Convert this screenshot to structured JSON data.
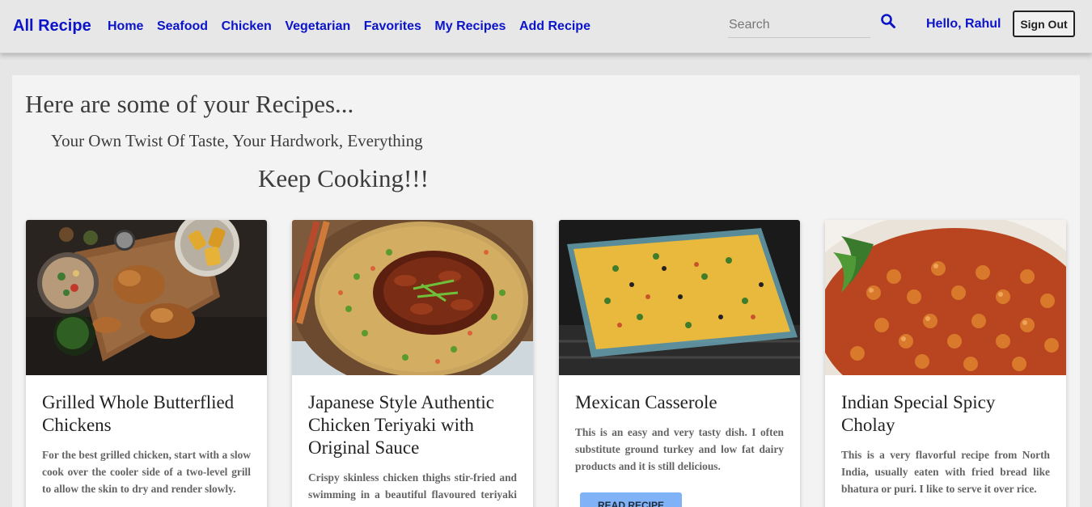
{
  "nav": {
    "brand": "All Recipe",
    "links": [
      "Home",
      "Seafood",
      "Chicken",
      "Vegetarian",
      "Favorites",
      "My Recipes",
      "Add Recipe"
    ],
    "search_placeholder": "Search",
    "greeting": "Hello, Rahul",
    "sign_out": "Sign Out",
    "search_icon": "search-icon"
  },
  "header": {
    "title": "Here are some of your Recipes...",
    "subtitle": "Your Own Twist Of Taste, Your Hardwork, Everything",
    "tagline": "Keep Cooking!!!"
  },
  "recipes": [
    {
      "title": "Grilled Whole Butterflied Chickens",
      "description": "For the best grilled chicken, start with a slow cook over the cooler side of a two-level grill to allow the skin to dry and render slowly.",
      "image": "grilled-chicken-image"
    },
    {
      "title": "Japanese Style Authentic Chicken Teriyaki with Original Sauce",
      "description": "Crispy skinless chicken thighs stir-fried and swimming in a beautiful flavoured teriyaki sauce, served over fried rice.",
      "image": "chicken-teriyaki-image"
    },
    {
      "title": "Mexican Casserole",
      "description": "This is an easy and very tasty dish. I often substitute ground turkey and low fat dairy products and it is still delicious.",
      "image": "mexican-casserole-image",
      "button": "READ RECIPE"
    },
    {
      "title": "Indian Special Spicy Cholay",
      "description": "This is a very flavorful recipe from North India, usually eaten with fried bread like bhatura or puri. I like to serve it over rice.",
      "image": "cholay-image"
    }
  ],
  "colors": {
    "accent": "#0b14c9",
    "page_bg": "#e6e6e6",
    "panel_bg": "#f3f3f3",
    "button_bg": "#7fb2f7"
  }
}
